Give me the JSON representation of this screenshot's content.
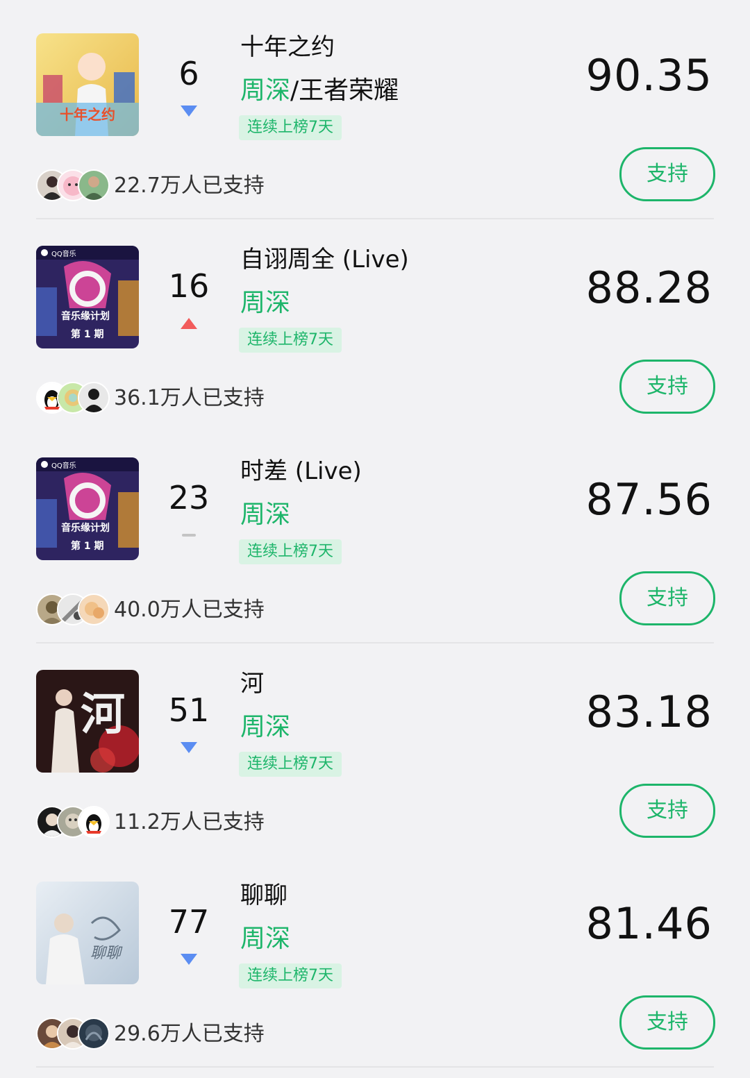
{
  "items": [
    {
      "rank": "6",
      "trend": "down",
      "title": "十年之约",
      "artist_primary": "周深",
      "artist_secondary": "/王者荣耀",
      "badge": "连续上榜7天",
      "score": "90.35",
      "supporters": "22.7万人已支持",
      "support_label": "支持",
      "cover_text": "十年之约",
      "colors": {
        "cover_bg": "#f4d36a",
        "cover_accent": "#6ab8e8"
      }
    },
    {
      "rank": "16",
      "trend": "up",
      "title": "自诩周全 (Live)",
      "artist_primary": "周深",
      "artist_secondary": "",
      "badge": "连续上榜7天",
      "score": "88.28",
      "supporters": "36.1万人已支持",
      "support_label": "支持",
      "cover_text": "第 1 期",
      "colors": {
        "cover_bg": "#3a2a6e",
        "cover_accent": "#e84aa0"
      }
    },
    {
      "rank": "23",
      "trend": "flat",
      "title": "时差 (Live)",
      "artist_primary": "周深",
      "artist_secondary": "",
      "badge": "连续上榜7天",
      "score": "87.56",
      "supporters": "40.0万人已支持",
      "support_label": "支持",
      "cover_text": "第 1 期",
      "colors": {
        "cover_bg": "#3a2a6e",
        "cover_accent": "#e84aa0"
      }
    },
    {
      "rank": "51",
      "trend": "down",
      "title": "河",
      "artist_primary": "周深",
      "artist_secondary": "",
      "badge": "连续上榜7天",
      "score": "83.18",
      "supporters": "11.2万人已支持",
      "support_label": "支持",
      "cover_text": "河",
      "colors": {
        "cover_bg": "#2a1414",
        "cover_accent": "#b8202a"
      }
    },
    {
      "rank": "77",
      "trend": "down",
      "title": "聊聊",
      "artist_primary": "周深",
      "artist_secondary": "",
      "badge": "连续上榜7天",
      "score": "81.46",
      "supporters": "29.6万人已支持",
      "support_label": "支持",
      "cover_text": "聊聊",
      "colors": {
        "cover_bg": "#cfdbe6",
        "cover_accent": "#8aa3b8"
      }
    }
  ],
  "colors": {
    "green": "#1db56a",
    "badge_bg": "#d9f3e4",
    "trend_up": "#f25b5b",
    "trend_down": "#5b8df2",
    "trend_flat": "#c4c4c4",
    "background": "#f2f2f4"
  }
}
